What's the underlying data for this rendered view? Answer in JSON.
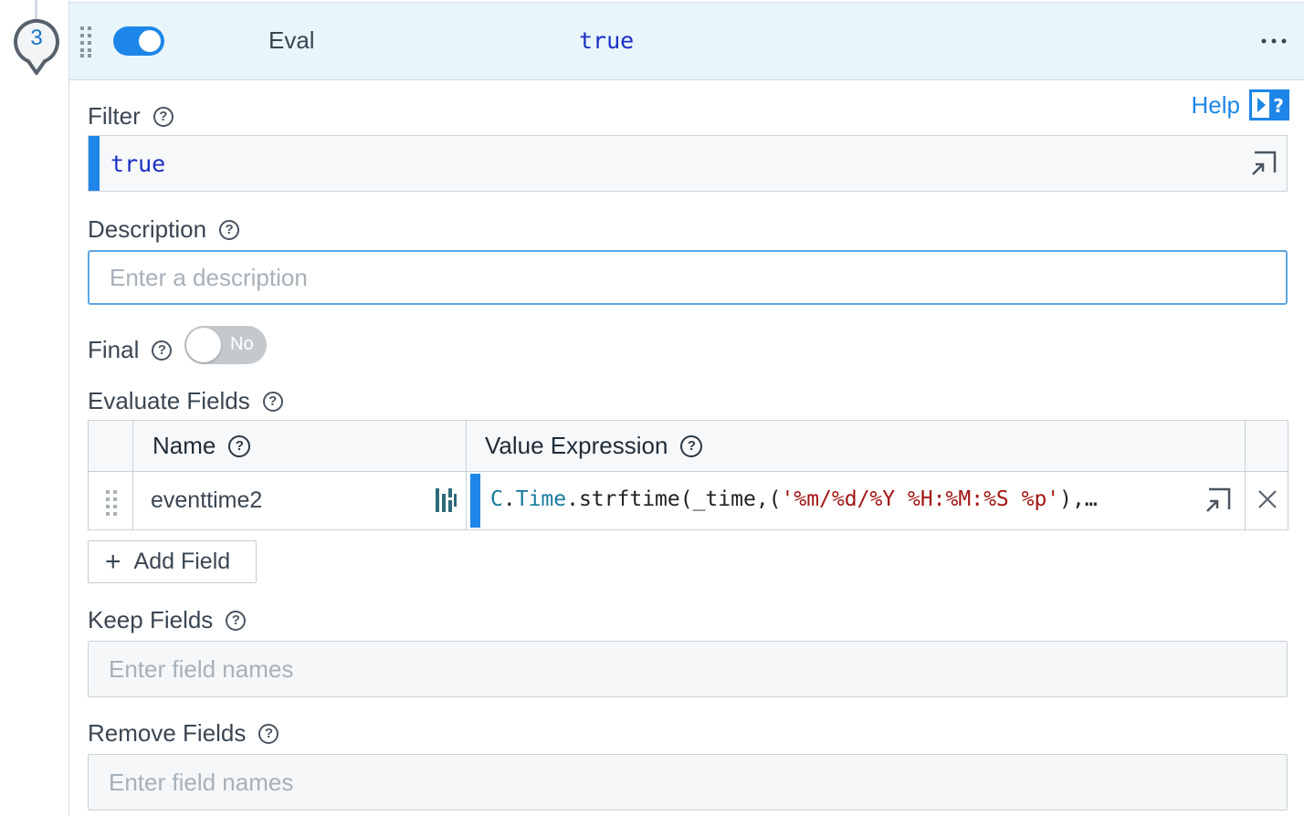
{
  "step": {
    "number": "3"
  },
  "header": {
    "enabled": true,
    "function_name": "Eval",
    "filter_summary": "true",
    "more_icon": "more-horizontal-icon"
  },
  "help": {
    "label": "Help",
    "icon": "help-panel-icon"
  },
  "filter": {
    "label": "Filter",
    "value": "true"
  },
  "description": {
    "label": "Description",
    "placeholder": "Enter a description",
    "value": ""
  },
  "final": {
    "label": "Final",
    "toggle_text": "No",
    "enabled": false
  },
  "evaluate_fields": {
    "label": "Evaluate Fields",
    "columns": {
      "name": "Name",
      "value_expression": "Value Expression"
    },
    "rows": [
      {
        "name": "eventtime2",
        "expr_obj": "C",
        "expr_dot1": ".",
        "expr_ns": "Time",
        "expr_fn": ".strftime(_time,(",
        "expr_str": "'%m/%d/%Y %H:%M:%S %p'",
        "expr_tail": "),…"
      }
    ],
    "add_label": "Add Field"
  },
  "keep_fields": {
    "label": "Keep Fields",
    "placeholder": "Enter field names"
  },
  "remove_fields": {
    "label": "Remove Fields",
    "placeholder": "Enter field names"
  },
  "colors": {
    "accent": "#1d86e8",
    "header_bg": "#e8f5fb",
    "code_keyword": "#1b2fc4",
    "code_string": "#a31515"
  }
}
